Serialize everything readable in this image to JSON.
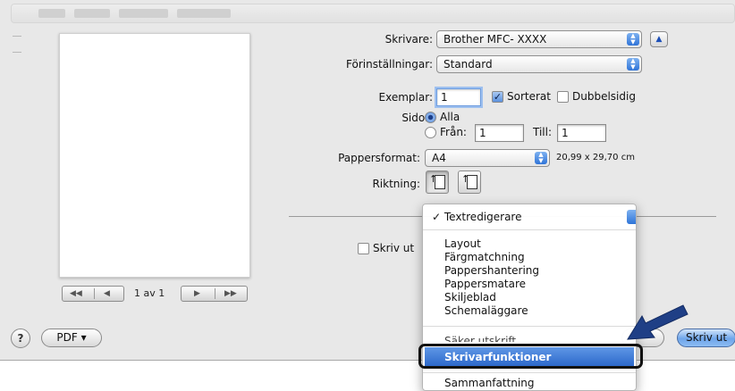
{
  "print_dialog": {
    "printer_label": "Skrivare:",
    "printer_value": "Brother MFC- XXXX",
    "presets_label": "Förinställningar:",
    "presets_value": "Standard",
    "copies_label": "Exemplar:",
    "copies_value": "1",
    "collated_label": "Sorterat",
    "collated_checked": true,
    "two_sided_label": "Dubbelsidig",
    "two_sided_checked": false,
    "pages_label": "Sidor:",
    "pages_all_label": "Alla",
    "pages_from_label": "Från:",
    "pages_from_value": "1",
    "pages_to_label": "Till:",
    "pages_to_value": "1",
    "paper_size_label": "Pappersformat:",
    "paper_size_value": "A4",
    "paper_size_dims": "20,99 x 29,70 cm",
    "orientation_label": "Riktning:",
    "print_selection_label": "Skriv ut"
  },
  "preview": {
    "page_count": "1 av 1"
  },
  "bottom_bar": {
    "help_label": "?",
    "pdf_label": "PDF ▾",
    "print_label": "Skriv ut"
  },
  "section_menu": {
    "checked_item": "✓ Textredigerare",
    "items": [
      "Layout",
      "Färgmatchning",
      "Pappershantering",
      "Pappersmatare",
      "Skiljeblad",
      "Schemaläggare"
    ],
    "partially_hidden_item": "Säker utskrift",
    "highlighted_item": "Skrivarfunktioner",
    "last_item": "Sammanfattning"
  },
  "colors": {
    "accent_blue": "#2a66c9",
    "callout_arrow": "#1f3f86"
  }
}
